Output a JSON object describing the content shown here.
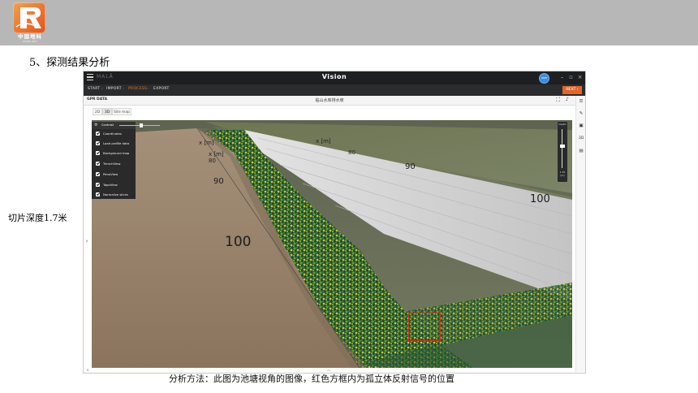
{
  "slide": {
    "logo_name": "中国地科",
    "logo_subtext": "CHINA GEO",
    "section_title": "5、探测结果分析",
    "side_note": "切片深度1.7米",
    "caption": "分析方法：此图为池塘视角的图像，红色方框内为孤立体反射信号的位置"
  },
  "app": {
    "brand": "MALÅ",
    "title": "Vision",
    "user_initials": "user",
    "steps": [
      "START",
      "IMPORT",
      "PROCESS",
      "EXPORT"
    ],
    "active_step": "PROCESS",
    "next_label": "NEXT",
    "subbar_left": "GPR DATA",
    "subbar_center": "临山水库排水坡",
    "view_tabs": [
      "2D",
      "3D",
      "Site map"
    ],
    "active_view": "3D",
    "panel": {
      "contrast_label": "Contrast",
      "options": [
        "Coordinates",
        "Load profile data",
        "Background map",
        "TrenchView",
        "PenoView",
        "TopoView",
        "Normalize slices"
      ]
    },
    "depth": {
      "label": "Depth",
      "value": "1.70",
      "unit": "(m)"
    },
    "scene_labels": {
      "distance_big": "100",
      "distance_80_left": "80",
      "distance_90_left": "90",
      "distance_80_right": "80",
      "distance_90_right": "90",
      "distance_100_right": "100",
      "axis_small_1": "x [m]",
      "axis_small_2": "x [m]",
      "axis_small_3": "x [m]"
    },
    "bottom_left": "x",
    "colors": {
      "accent_orange": "#e2652a",
      "titlebar": "#1e1f21",
      "marker_red": "#d22b1a"
    }
  }
}
